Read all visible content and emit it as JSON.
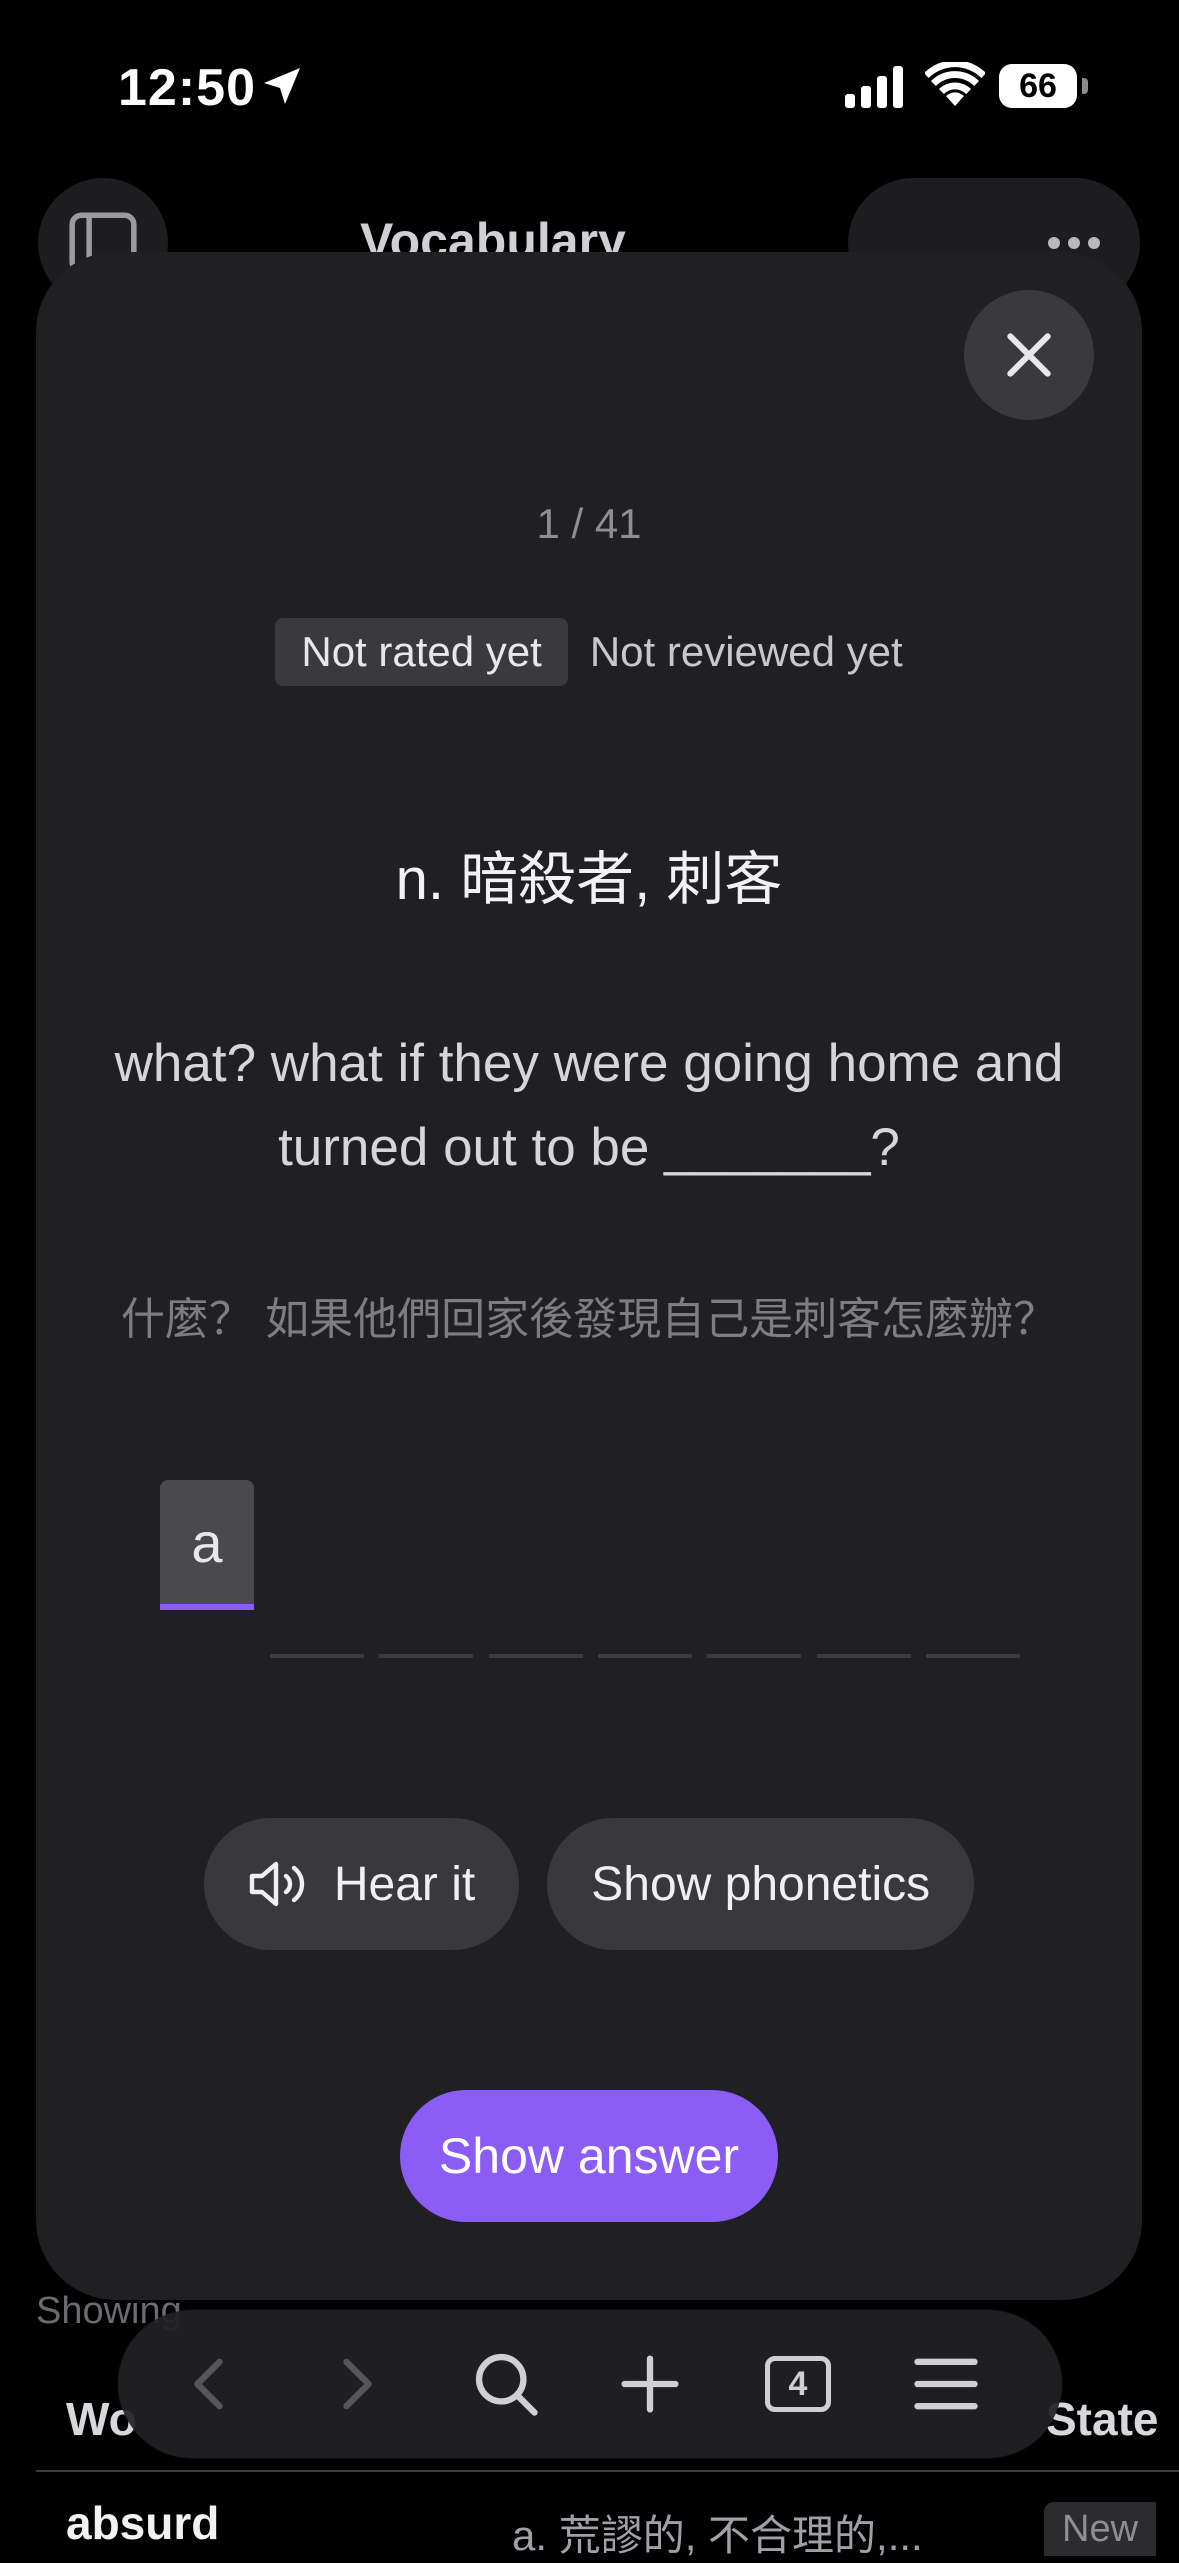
{
  "status_bar": {
    "time": "12:50",
    "battery_percent": "66"
  },
  "background": {
    "nav_title": "Vocabulary",
    "showing_text": "Showing",
    "table": {
      "columns": [
        "Wo",
        "State"
      ],
      "rows": [
        {
          "word": "absurd",
          "definition": "a. 荒謬的, 不合理的,...",
          "state": "New"
        }
      ]
    }
  },
  "card": {
    "progress": "1 / 41",
    "badges": {
      "rating": "Not rated yet",
      "review": "Not reviewed yet"
    },
    "definition": "n. 暗殺者, 刺客",
    "sentence": "what? what if they were going home and turned out to be _______?",
    "translation": "什麼？ 如果他們回家後發現自己是刺客怎麼辦？",
    "answer_letters": [
      "a",
      "",
      "",
      "",
      "",
      "",
      "",
      ""
    ],
    "buttons": {
      "hear": "Hear it",
      "phonetics": "Show phonetics",
      "show_answer": "Show answer"
    }
  },
  "toolbar": {
    "tab_count": "4"
  },
  "colors": {
    "accent": "#8b5cf6",
    "card_bg": "#202022",
    "pill_bg": "#39393c"
  }
}
